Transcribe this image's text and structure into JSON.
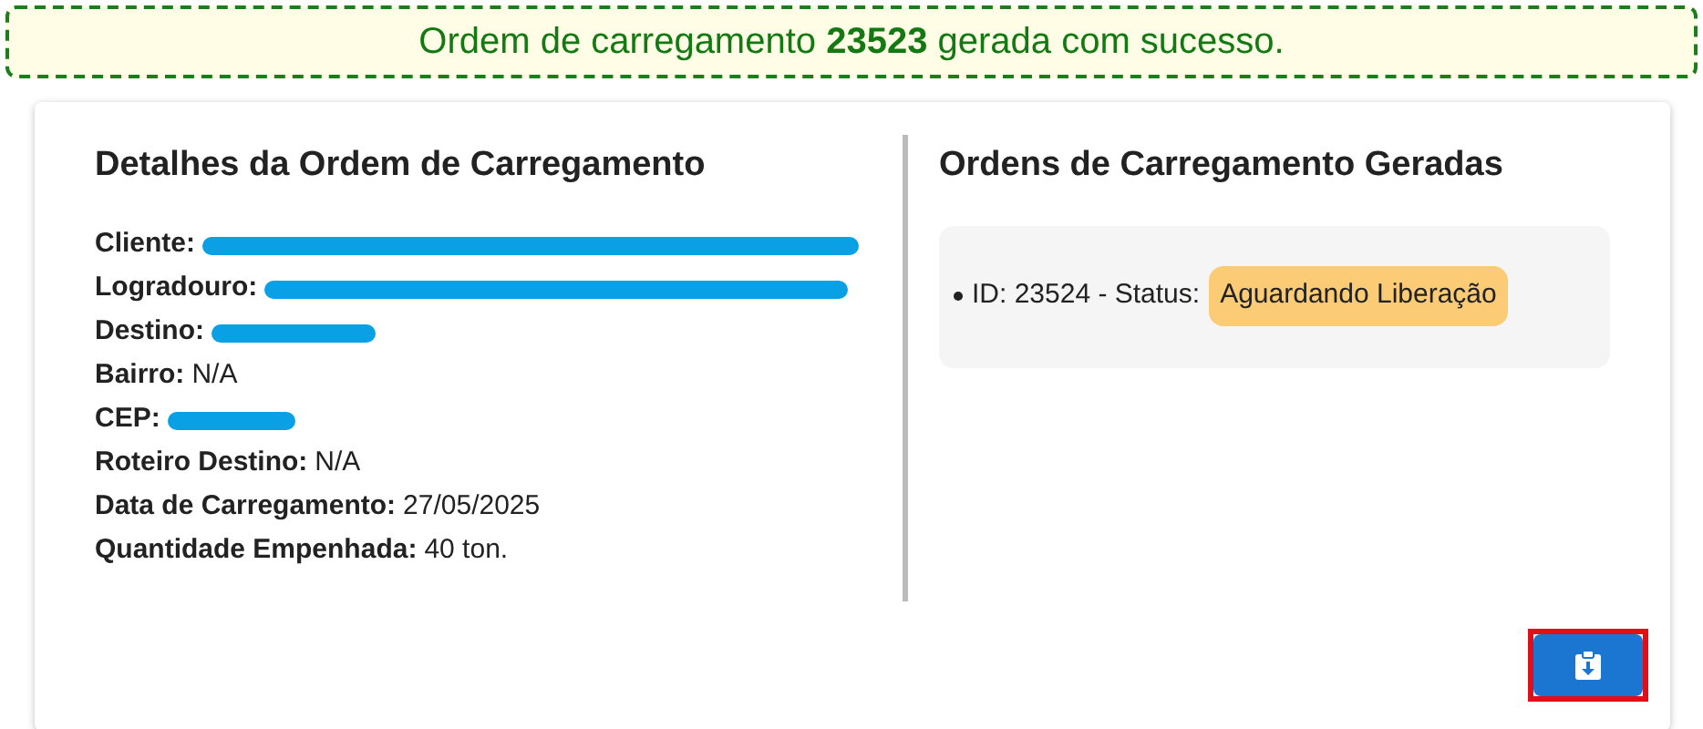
{
  "banner": {
    "message": "Ordem de carregamento **23523** gerada com sucesso."
  },
  "details": {
    "title": "Detalhes da Ordem de Carregamento",
    "fields": [
      {
        "label": "Cliente:",
        "kind": "redacted"
      },
      {
        "label": "Logradouro:",
        "kind": "redacted"
      },
      {
        "label": "Destino:",
        "kind": "redacted"
      },
      {
        "label": "Bairro:",
        "kind": "text",
        "value": "N/A"
      },
      {
        "label": "CEP:",
        "kind": "redacted"
      },
      {
        "label": "Roteiro Destino:",
        "kind": "text",
        "value": "N/A"
      },
      {
        "label": "Data de Carregamento:",
        "kind": "text",
        "value": "27/05/2025"
      },
      {
        "label": "Quantidade Empenhada:",
        "kind": "text",
        "value": "40 ton."
      }
    ]
  },
  "orders": {
    "title": "Ordens de Carregamento Geradas",
    "items": [
      {
        "text": "ID: 23524 - Status:",
        "status": "Aguardando Liberação",
        "color": "#fbcb75"
      }
    ]
  },
  "download_button": {
    "highlighted": true
  }
}
